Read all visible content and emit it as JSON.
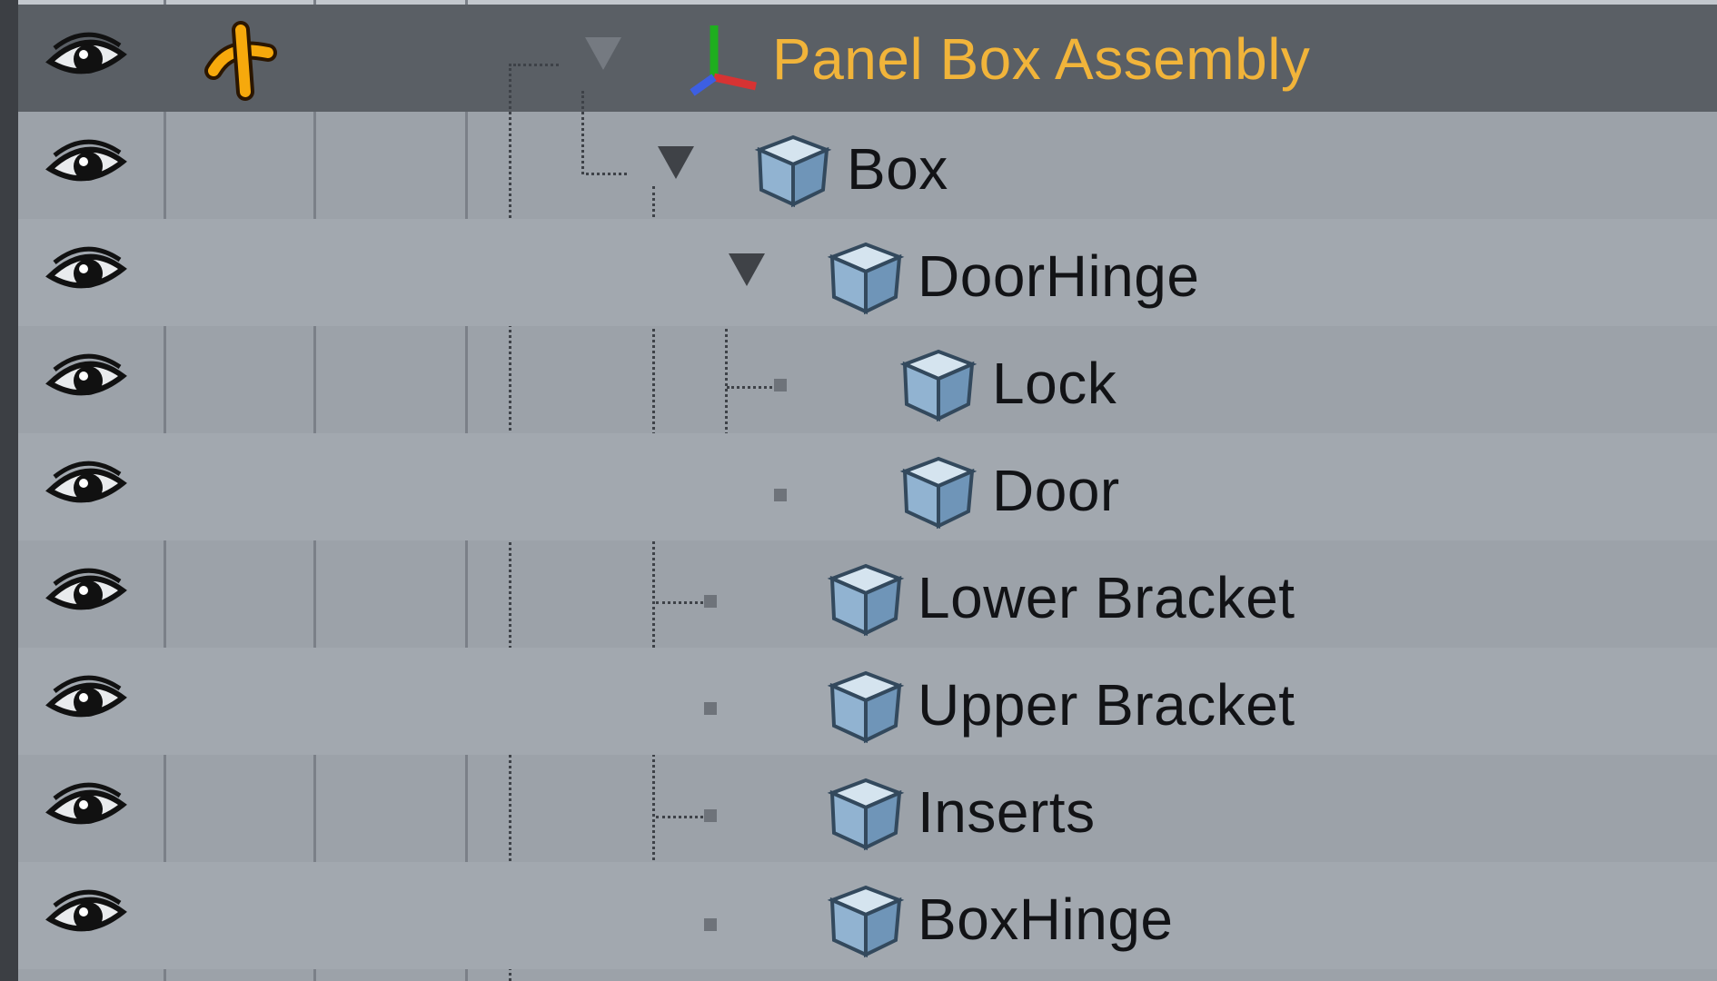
{
  "colors": {
    "selected_row_bg": "#5a5f65",
    "row_bg": "#9ca2a9",
    "selected_text": "#f1b43a",
    "text": "#121316",
    "cube_face_light": "#c7dbe9",
    "cube_face_mid": "#8fb3d2",
    "cube_face_dark": "#6d92b4"
  },
  "outliner": {
    "root": {
      "label": "Panel Box Assembly",
      "icon": "axes-locator-icon",
      "center_icon": "center-pivot-icon",
      "expanded": true,
      "selected": true
    },
    "items": [
      {
        "label": "Box",
        "icon": "mesh-cube-icon",
        "depth": 1,
        "expanded": true
      },
      {
        "label": "DoorHinge",
        "icon": "mesh-cube-icon",
        "depth": 2,
        "expanded": true
      },
      {
        "label": "Lock",
        "icon": "mesh-cube-icon",
        "depth": 3,
        "expanded": false
      },
      {
        "label": "Door",
        "icon": "mesh-cube-icon",
        "depth": 3,
        "expanded": false
      },
      {
        "label": "Lower Bracket",
        "icon": "mesh-cube-icon",
        "depth": 2,
        "expanded": false
      },
      {
        "label": "Upper Bracket",
        "icon": "mesh-cube-icon",
        "depth": 2,
        "expanded": false
      },
      {
        "label": "Inserts",
        "icon": "mesh-cube-icon",
        "depth": 2,
        "expanded": false
      },
      {
        "label": "BoxHinge",
        "icon": "mesh-cube-icon",
        "depth": 2,
        "expanded": false
      }
    ],
    "visibility_icon": "eye-icon"
  }
}
